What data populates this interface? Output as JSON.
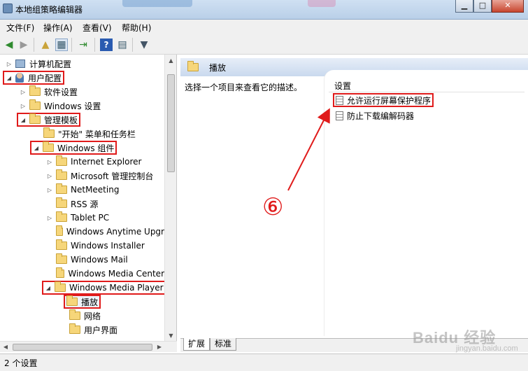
{
  "window": {
    "title": "本地组策略编辑器",
    "minimize_glyph": "▁",
    "maximize_glyph": "□",
    "close_glyph": "✕"
  },
  "menu": [
    "文件(F)",
    "操作(A)",
    "查看(V)",
    "帮助(H)"
  ],
  "toolbar_icons": [
    "back-arrow-icon",
    "forward-arrow-icon",
    "up-folder-icon",
    "show-hide-tree-icon",
    "export-list-icon",
    "help-icon",
    "properties-icon",
    "filter-icon"
  ],
  "tree": {
    "computer_config": "计算机配置",
    "user_config": "用户配置",
    "software_settings": "软件设置",
    "windows_settings": "Windows 设置",
    "admin_templates": "管理模板",
    "start_menu": "\"开始\" 菜单和任务栏",
    "windows_components": "Windows 组件",
    "internet_explorer": "Internet Explorer",
    "mmc": "Microsoft 管理控制台",
    "netmeeting": "NetMeeting",
    "rss": "RSS 源",
    "tablet_pc": "Tablet PC",
    "anytime_upgrade": "Windows Anytime Upgr",
    "installer": "Windows Installer",
    "mail": "Windows Mail",
    "media_center": "Windows Media Center",
    "media_player": "Windows Media Player",
    "playback": "播放",
    "network": "网络",
    "user_interface": "用户界面"
  },
  "right": {
    "header_title": "播放",
    "description": "选择一个项目来查看它的描述。",
    "settings_header": "设置",
    "settings": [
      "允许运行屏幕保护程序",
      "防止下载编解码器"
    ]
  },
  "tabs": [
    "扩展",
    "标准"
  ],
  "status": "2 个设置",
  "annotation": {
    "step_label": "⑥",
    "color": "#e01b1b"
  },
  "watermark": {
    "main": "Baidu 经验",
    "sub": "jingyan.baidu.com"
  }
}
